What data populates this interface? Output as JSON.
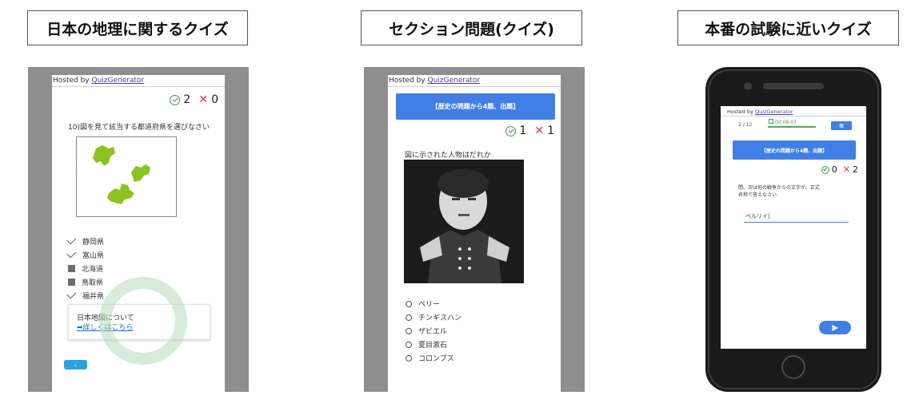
{
  "headers": [
    "日本の地理に関するクイズ",
    "セクション問題(クイズ)",
    "本番の試験に近いクイズ"
  ],
  "hosted_prefix": "Hosted by ",
  "hosted_link": "QuizGenerator",
  "left": {
    "correct_count": "2",
    "wrong_count": "0",
    "question": "10)図を見て該当する都道府県を選びなさい",
    "options": [
      {
        "mark": "check",
        "label": "静岡県"
      },
      {
        "mark": "check",
        "label": "富山県"
      },
      {
        "mark": "square",
        "label": "北海道"
      },
      {
        "mark": "square",
        "label": "鳥取県"
      },
      {
        "mark": "check",
        "label": "福井県"
      }
    ],
    "info_title": "日本地図について",
    "info_link": "➡詳しくはこちら",
    "back_label": "‹"
  },
  "middle": {
    "section_button": "【歴史の問題から4題、出題】",
    "correct_count": "1",
    "wrong_count": "1",
    "question": "図に示された人物はだれか",
    "options": [
      "ペリー",
      "チンギスハン",
      "ザビエル",
      "夏目漱石",
      "コロンブス"
    ]
  },
  "right": {
    "progress": "2 / 12",
    "timer": "00:09:07",
    "menu_label": "≡",
    "section_button": "【歴史の問題から4題、出題】",
    "correct_count": "0",
    "wrong_count": "2",
    "question_line1": "問、次は何の戦争からの文字が、正式",
    "question_line2": "名称で答えなさい",
    "answer_value": "ペルリイ|",
    "submit_icon": "send-icon"
  },
  "colors": {
    "panel_gray": "#8e8e8e",
    "accent_blue": "#3f7fe6",
    "map_green": "#8cc21f",
    "correct_green": "#3a9a3a",
    "wrong_red": "#e53935"
  }
}
